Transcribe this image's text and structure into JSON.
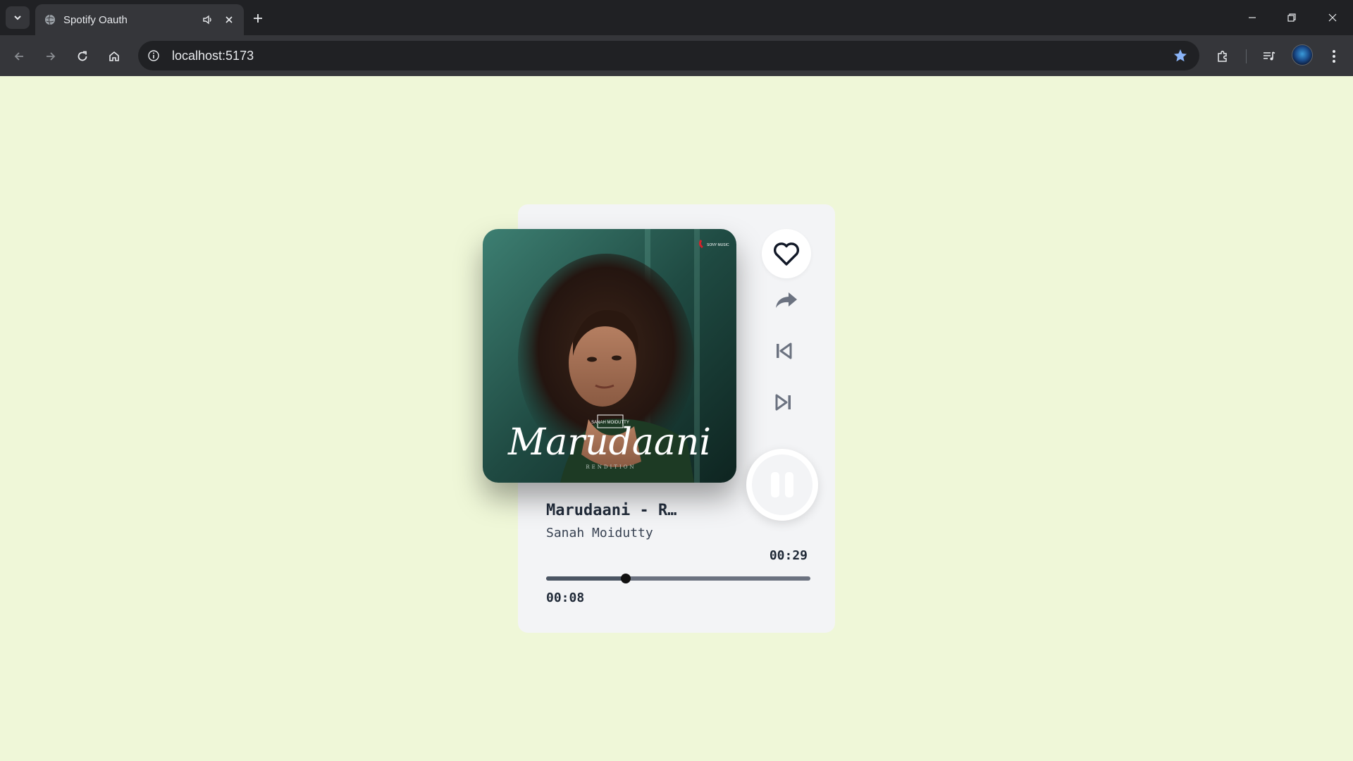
{
  "browser": {
    "tab_title": "Spotify Oauth",
    "url": "localhost:5173",
    "icons": {
      "tab_search": "chevron-down-icon",
      "favicon": "globe-icon",
      "audio": "speaker-icon",
      "close_tab": "close-icon",
      "new_tab": "plus-icon",
      "back": "arrow-left-icon",
      "forward": "arrow-right-icon",
      "reload": "reload-icon",
      "home": "home-icon",
      "site_info": "info-icon",
      "bookmark": "star-icon",
      "extensions": "puzzle-icon",
      "media": "media-queue-icon",
      "menu": "kebab-menu-icon"
    },
    "bookmark_color": "#8ab4f8"
  },
  "player": {
    "cover": {
      "title_text": "Marudaani",
      "subtitle_text": "RENDITION",
      "badge_text": "SANAH MOIDUTTY",
      "label_text": "SONY MUSIC"
    },
    "song_title": "Marudaani - R…",
    "artist": "Sanah Moidutty",
    "time_total": "00:29",
    "time_current": "00:08",
    "progress_fraction": 0.3,
    "liked": false,
    "is_playing": true,
    "controls": {
      "like": "heart-icon",
      "share": "share-icon",
      "previous": "skip-previous-icon",
      "next": "skip-next-icon",
      "pause": "pause-icon"
    },
    "colors": {
      "background": "#eff7d8",
      "card": "#f3f4f6",
      "text": "#1f2937"
    }
  }
}
